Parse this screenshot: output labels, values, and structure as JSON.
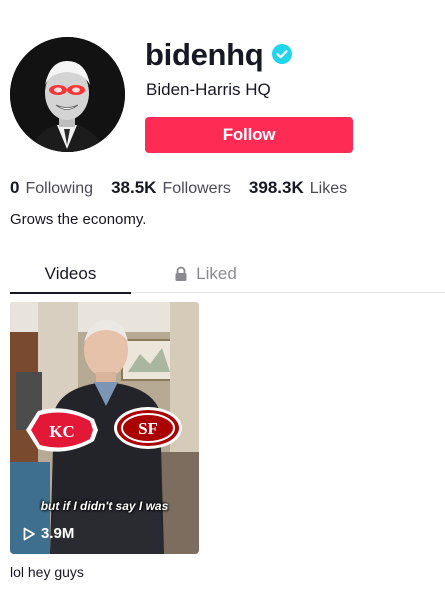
{
  "profile": {
    "username": "bidenhq",
    "display_name": "Biden-Harris HQ",
    "follow_label": "Follow",
    "bio": "Grows the economy.",
    "verified_icon": "verified-badge-icon"
  },
  "stats": [
    {
      "value": "0",
      "label": "Following"
    },
    {
      "value": "38.5K",
      "label": "Followers"
    },
    {
      "value": "398.3K",
      "label": "Likes"
    }
  ],
  "tabs": {
    "videos": "Videos",
    "liked": "Liked",
    "liked_icon": "lock-icon"
  },
  "videos": [
    {
      "views": "3.9M",
      "overlay_text": "but if I didn't say I was",
      "title": "lol hey guys",
      "view_icon": "play-icon"
    }
  ],
  "colors": {
    "accent": "#fe2c55",
    "verified": "#20d5ec",
    "text": "#161823",
    "muted": "#4a4b55"
  }
}
